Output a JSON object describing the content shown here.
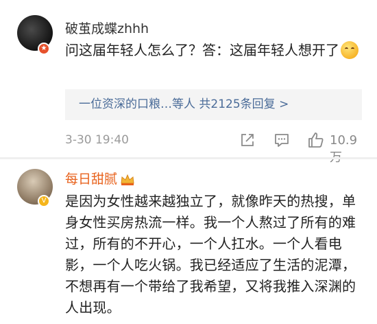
{
  "comments": [
    {
      "username": "破茧成蝶zhhh",
      "text": "问这届年轻人怎么了？答：这届年轻人想开了",
      "reply_summary": "一位资深的口粮…等人  共2125条回复 >",
      "time": "3-30 19:40",
      "likes": "10.9万"
    },
    {
      "username": "每日甜腻",
      "text": "是因为女性越来越独立了，就像昨天的热搜，单身女性买房热流一样。我一个人熬过了所有的难过，所有的不开心，一个人扛水。一个人看电影，一个人吃火锅。我已经适应了生活的泥潭，不想再有一个带给了我希望，又将我推入深渊的人出现。"
    }
  ],
  "icons": {
    "share": "share-icon",
    "comment": "comment-icon",
    "like": "thumbs-up-icon"
  },
  "colors": {
    "link": "#4a6b98",
    "vip_name": "#e8621c",
    "muted": "#9a9a9a"
  }
}
